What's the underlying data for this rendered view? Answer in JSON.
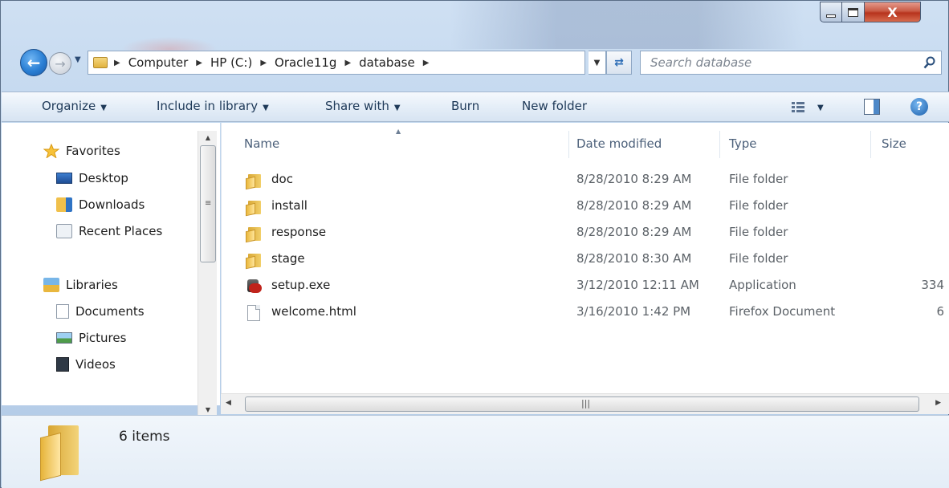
{
  "window": {
    "close_glyph": "X",
    "colors": {
      "accent": "#2a7fd4",
      "close": "#c95b45",
      "toolbar": "#e5eef8"
    }
  },
  "address": {
    "crumbs": [
      "Computer",
      "HP (C:)",
      "Oracle11g",
      "database"
    ]
  },
  "search": {
    "placeholder": "Search database"
  },
  "toolbar": {
    "organize": "Organize",
    "include_in_library": "Include in library",
    "share_with": "Share with",
    "burn": "Burn",
    "new_folder": "New folder"
  },
  "navigation": {
    "favorites": {
      "label": "Favorites",
      "items": [
        "Desktop",
        "Downloads",
        "Recent Places"
      ]
    },
    "libraries": {
      "label": "Libraries",
      "items": [
        "Documents",
        "Pictures",
        "Videos"
      ]
    }
  },
  "columns": {
    "name": "Name",
    "date": "Date modified",
    "type": "Type",
    "size": "Size"
  },
  "files": [
    {
      "name": "doc",
      "date": "8/28/2010 8:29 AM",
      "type": "File folder",
      "size": "",
      "icon": "folder-icon"
    },
    {
      "name": "install",
      "date": "8/28/2010 8:29 AM",
      "type": "File folder",
      "size": "",
      "icon": "folder-icon"
    },
    {
      "name": "response",
      "date": "8/28/2010 8:29 AM",
      "type": "File folder",
      "size": "",
      "icon": "folder-icon"
    },
    {
      "name": "stage",
      "date": "8/28/2010 8:30 AM",
      "type": "File folder",
      "size": "",
      "icon": "folder-icon"
    },
    {
      "name": "setup.exe",
      "date": "3/12/2010 12:11 AM",
      "type": "Application",
      "size": "334",
      "icon": "application-icon"
    },
    {
      "name": "welcome.html",
      "date": "3/16/2010 1:42 PM",
      "type": "Firefox Document",
      "size": "6",
      "icon": "document-icon"
    }
  ],
  "details": {
    "count": "6 items"
  }
}
